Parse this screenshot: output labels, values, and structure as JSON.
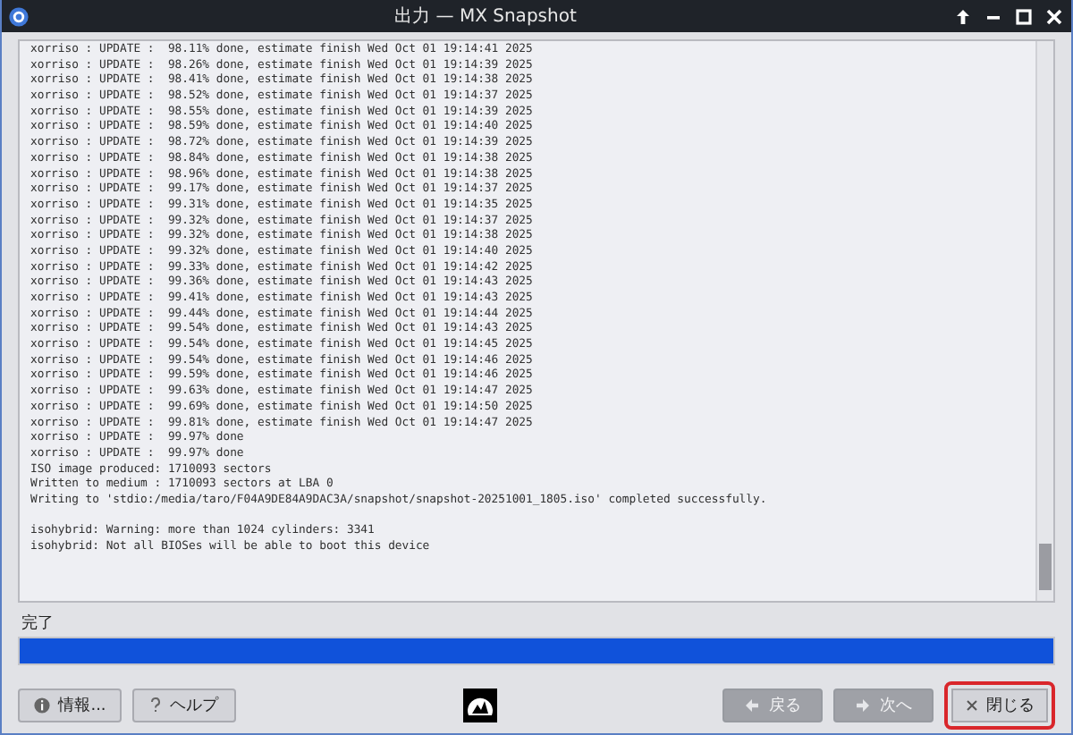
{
  "window": {
    "title": "出力 — MX Snapshot"
  },
  "log": {
    "blocks": [
      [
        "xorriso : UPDATE :  98.11% done, estimate finish Wed Oct 01 19:14:41 2025",
        "xorriso : UPDATE :  98.26% done, estimate finish Wed Oct 01 19:14:39 2025",
        "xorriso : UPDATE :  98.41% done, estimate finish Wed Oct 01 19:14:38 2025",
        "xorriso : UPDATE :  98.52% done, estimate finish Wed Oct 01 19:14:37 2025",
        "xorriso : UPDATE :  98.55% done, estimate finish Wed Oct 01 19:14:39 2025",
        "xorriso : UPDATE :  98.59% done, estimate finish Wed Oct 01 19:14:40 2025",
        "xorriso : UPDATE :  98.72% done, estimate finish Wed Oct 01 19:14:39 2025",
        "xorriso : UPDATE :  98.84% done, estimate finish Wed Oct 01 19:14:38 2025",
        "xorriso : UPDATE :  98.96% done, estimate finish Wed Oct 01 19:14:38 2025",
        "xorriso : UPDATE :  99.17% done, estimate finish Wed Oct 01 19:14:37 2025",
        "xorriso : UPDATE :  99.31% done, estimate finish Wed Oct 01 19:14:35 2025",
        "xorriso : UPDATE :  99.32% done, estimate finish Wed Oct 01 19:14:37 2025",
        "xorriso : UPDATE :  99.32% done, estimate finish Wed Oct 01 19:14:38 2025",
        "xorriso : UPDATE :  99.32% done, estimate finish Wed Oct 01 19:14:40 2025",
        "xorriso : UPDATE :  99.33% done, estimate finish Wed Oct 01 19:14:42 2025",
        "xorriso : UPDATE :  99.36% done, estimate finish Wed Oct 01 19:14:43 2025",
        "xorriso : UPDATE :  99.41% done, estimate finish Wed Oct 01 19:14:43 2025",
        "xorriso : UPDATE :  99.44% done, estimate finish Wed Oct 01 19:14:44 2025",
        "xorriso : UPDATE :  99.54% done, estimate finish Wed Oct 01 19:14:43 2025",
        "xorriso : UPDATE :  99.54% done, estimate finish Wed Oct 01 19:14:45 2025",
        "xorriso : UPDATE :  99.54% done, estimate finish Wed Oct 01 19:14:46 2025",
        "xorriso : UPDATE :  99.59% done, estimate finish Wed Oct 01 19:14:46 2025",
        "xorriso : UPDATE :  99.63% done, estimate finish Wed Oct 01 19:14:47 2025",
        "xorriso : UPDATE :  99.69% done, estimate finish Wed Oct 01 19:14:50 2025",
        "xorriso : UPDATE :  99.81% done, estimate finish Wed Oct 01 19:14:47 2025",
        "xorriso : UPDATE :  99.97% done",
        "xorriso : UPDATE :  99.97% done",
        "ISO image produced: 1710093 sectors",
        "Written to medium : 1710093 sectors at LBA 0",
        "Writing to 'stdio:/media/taro/F04A9DE84A9DAC3A/snapshot/snapshot-20251001_1805.iso' completed successfully."
      ],
      [
        "isohybrid: Warning: more than 1024 cylinders: 3341",
        "isohybrid: Not all BIOSes will be able to boot this device"
      ]
    ]
  },
  "status": "完了",
  "progress": {
    "level": 1.0
  },
  "buttons": [
    {
      "kind": "info",
      "label": "情報...",
      "disabled": false,
      "focused": false
    },
    {
      "kind": "help",
      "label": "ヘルプ",
      "disabled": false,
      "focused": false
    },
    {
      "kind": "back",
      "label": "戻る",
      "disabled": true,
      "focused": false
    },
    {
      "kind": "next",
      "label": "次へ",
      "disabled": true,
      "focused": false
    },
    {
      "kind": "close",
      "label": "閉じる",
      "disabled": false,
      "focused": true
    }
  ]
}
